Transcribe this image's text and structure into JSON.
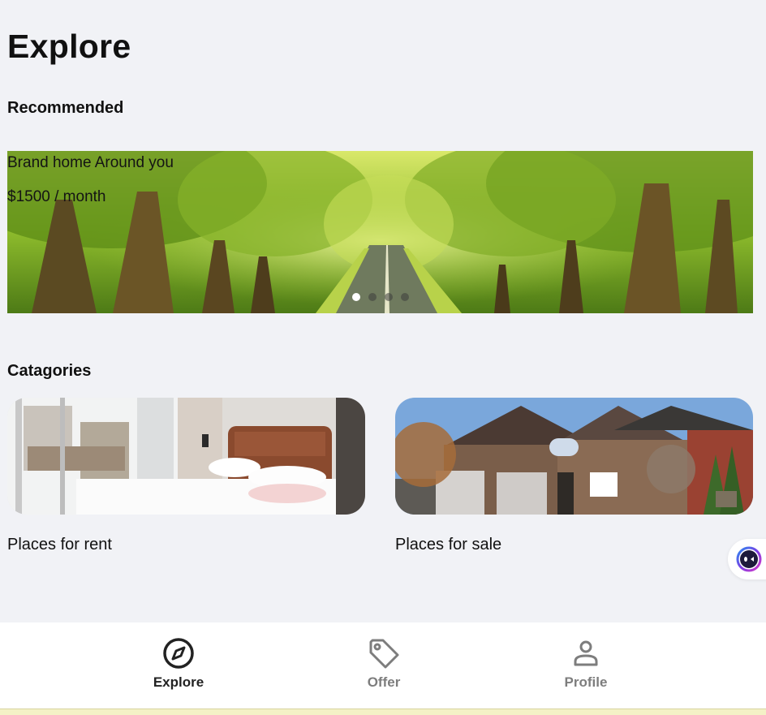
{
  "page": {
    "title": "Explore"
  },
  "recommended": {
    "title": "Recommended",
    "banner": {
      "title": "Brand home Around you",
      "price": "$1500 / month",
      "slide_count": 4,
      "active_slide": 1
    }
  },
  "categories": {
    "title": "Catagories",
    "items": [
      {
        "label": "Places for rent"
      },
      {
        "label": "Places for sale"
      }
    ]
  },
  "bottom_nav": {
    "items": [
      {
        "label": "Explore",
        "icon": "compass-icon",
        "active": true
      },
      {
        "label": "Offer",
        "icon": "tag-icon",
        "active": false
      },
      {
        "label": "Profile",
        "icon": "user-icon",
        "active": false
      }
    ]
  },
  "colors": {
    "background": "#f1f2f6",
    "nav_active": "#222222",
    "nav_inactive": "#7d7d7d",
    "assistant_accent": "#7b3fe4"
  }
}
